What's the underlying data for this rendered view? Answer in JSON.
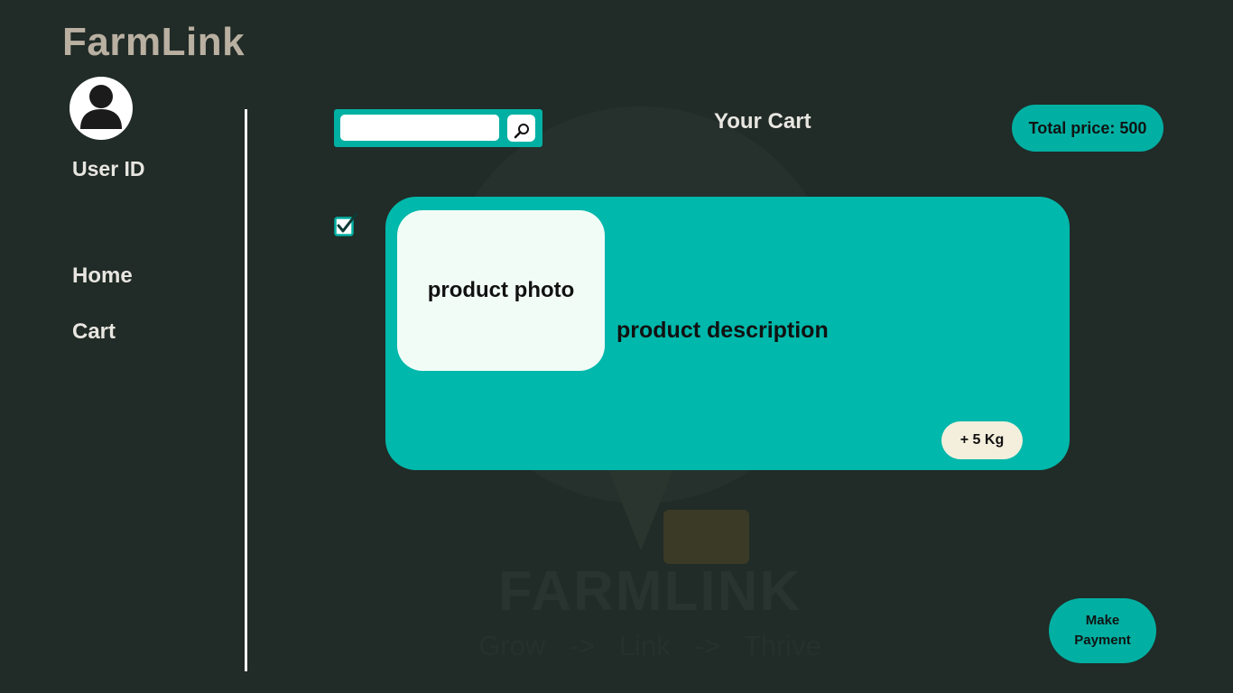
{
  "app": {
    "brand": "FarmLink"
  },
  "sidebar": {
    "user_id_label": "User ID",
    "nav": [
      {
        "label": "Home"
      },
      {
        "label": "Cart"
      }
    ]
  },
  "watermark": {
    "title": "FARMLINK",
    "subtitle": "Grow  ->  Link  ->  Thrive"
  },
  "search": {
    "value": "",
    "placeholder": "",
    "icon": "search-icon"
  },
  "cart": {
    "title": "Your Cart",
    "total_price": "Total price: 500",
    "items": [
      {
        "selected": true,
        "photo_label": "product photo",
        "description": "product description",
        "quantity": "+ 5 Kg"
      }
    ]
  },
  "actions": {
    "make_payment": "Make Payment"
  },
  "colors": {
    "background": "#212b27",
    "accent": "#02b0a3",
    "card": "#00b8ab",
    "brand_text": "#b9b0a1",
    "badge": "#f4efdd"
  }
}
